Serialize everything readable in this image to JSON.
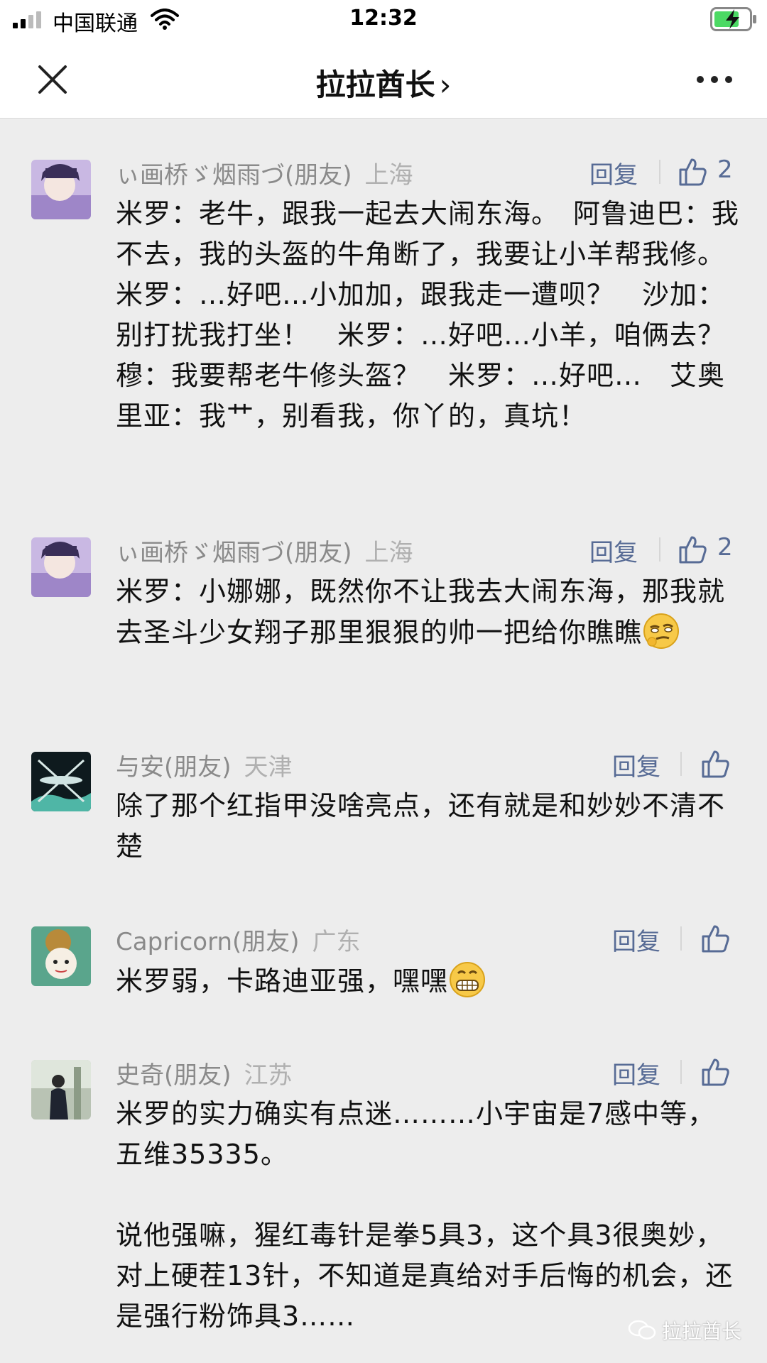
{
  "status_bar": {
    "carrier": "中国联通",
    "time": "12:32"
  },
  "nav": {
    "title": "拉拉酋长",
    "chevron": "›"
  },
  "comments": [
    {
      "name": "ぃ画桥ゞ烟雨づ(朋友)",
      "location": "上海",
      "reply_label": "回复",
      "likes": "2",
      "text": "米罗：老牛，跟我一起去大闹东海。　阿鲁迪巴：我不去，我的头盔的牛角断了，我要让小羊帮我修。米罗：…好吧…小加加，跟我走一遭呗？　沙加：别打扰我打坐！　米罗：…好吧…小羊，咱俩去？　穆：我要帮老牛修头盔？　米罗：…好吧…　艾奥里亚：我艹，别看我，你丫的，真坑！"
    },
    {
      "name": "ぃ画桥ゞ烟雨づ(朋友)",
      "location": "上海",
      "reply_label": "回复",
      "likes": "2",
      "text": "米罗：小娜娜，既然你不让我去大闹东海，那我就去圣斗少女翔子那里狠狠的帅一把给你瞧瞧"
    },
    {
      "name": "与安(朋友)",
      "location": "天津",
      "reply_label": "回复",
      "text": "除了那个红指甲没啥亮点，还有就是和妙妙不清不楚"
    },
    {
      "name": "Capricorn(朋友)",
      "location": "广东",
      "reply_label": "回复",
      "text": "米罗弱，卡路迪亚强，嘿嘿"
    },
    {
      "name": "史奇(朋友)",
      "location": "江苏",
      "reply_label": "回复",
      "text_p1": "米罗的实力确实有点迷………小宇宙是7感中等，五维35335。",
      "text_p2": "说他强嘛，猩红毒针是拳5具3，这个具3很奥妙，对上硬茬13针，不知道是真给对手后悔的机会，还是强行粉饰具3……"
    }
  ],
  "watermark": "拉拉酋长",
  "colors": {
    "link": "#576b95",
    "background": "#ededed",
    "name": "#8a8a8a"
  }
}
